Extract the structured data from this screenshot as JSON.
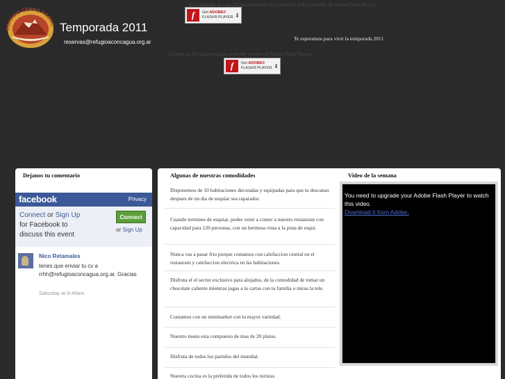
{
  "header": {
    "logo_text": "REFUGIO CERRO ACONCAGUA",
    "title": "Temporada 2011",
    "email": "reservas@refugioaconcagua.org.ar"
  },
  "flash": {
    "message_top": "El contenido de esta pÃ¡gina requiere una versiÃ³n mÃ¡s reciente de Adobe Flash Player.",
    "message_bottom": "Content on this page requires a newer version of Adobe Flash Player.",
    "button_get": "Get",
    "button_adobe": "ADOBE®",
    "button_player": "FLASH® PLAYER",
    "tagline": "Te esperamos para vivir la temporada 2011."
  },
  "comments": {
    "heading": "Dejanos tu comentario",
    "fb_logo": "facebook",
    "fb_privacy": "Privacy",
    "fb_connect": "Connect",
    "fb_or": "or",
    "fb_signup": "Sign Up",
    "fb_to_discuss": "for Facebook to discuss this event",
    "fb_connect_button": "Connect",
    "comment": {
      "author": "Nico Retamales",
      "text": "tenes que enviar tu cv a rrhh@refugioaconcagua.org.ar. Gracias",
      "time": "Saturday at 8:49am"
    }
  },
  "amenities": {
    "heading": "Algunas de nuestras comodidades",
    "items": [
      "Disponemos de 10 habitaciones decoradas y equipadas para que tu descanso despues de un dia de esquiar sea raparador.",
      "Cuando termines de esquiar, podes venir a comer a nuestro restaurant con capacidad para 120 personas, con un hermosa vista a la pista de esqui.",
      "Nunca vas a pasar frio porque contamos con calefaccion central en el restaurant y calefaccion electrica en las habitaciones.",
      "Disfruta el el sector exclusivo para alojados, de la comodidad de tomar un chocolate caliente mientras jugas a la cartas con tu familia o miras la tele.",
      "Contamos con un minimarket con la mayor variedad.",
      "Nuestro menu esta compuesto de mas de 20 platos.",
      "Disfruta de todos los partidos del mundial.",
      "Nuestra cocina es la preferida de todos los turistas"
    ]
  },
  "video": {
    "heading": "Video de la semana",
    "message": "You need to upgrade your Adobe Flash Player to watch this video.",
    "link": "Download it from Adobe."
  },
  "colors": {
    "background": "#2a2a2a",
    "facebook_blue": "#3b5998",
    "connect_green": "#5b9f3a",
    "flash_red": "#c0151b"
  }
}
